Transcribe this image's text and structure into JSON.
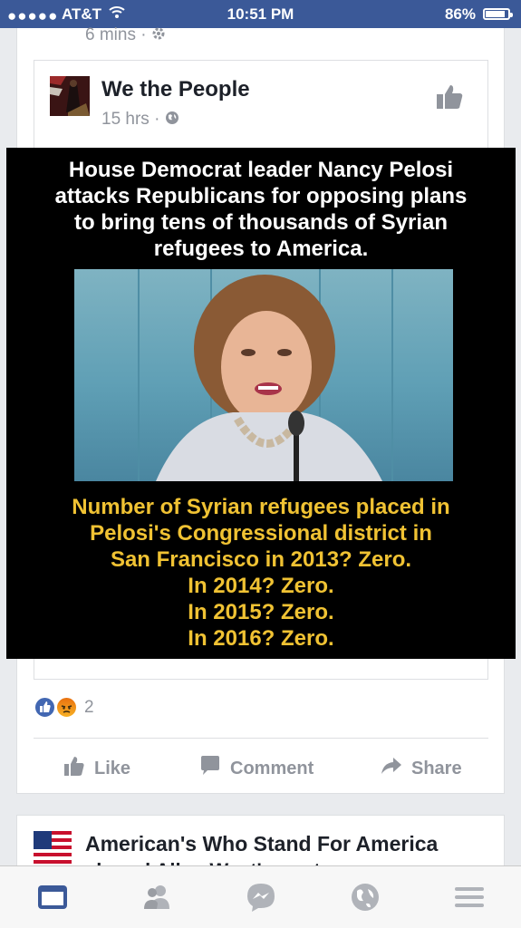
{
  "status_bar": {
    "signal_dots": "●●●●●",
    "carrier": "AT&T",
    "time": "10:51 PM",
    "battery_percent": "86%",
    "battery_level": 0.86
  },
  "previous_post": {
    "meta": "6 mins ·"
  },
  "post": {
    "page_name": "We the People",
    "meta": "15 hrs ·",
    "image": {
      "headline": [
        "House Democrat leader Nancy Pelosi",
        "attacks Republicans for opposing plans",
        "to bring tens of thousands of Syrian",
        "refugees to America."
      ],
      "caption": [
        "Number of Syrian refugees placed in",
        "Pelosi's Congressional district in",
        "San Francisco in 2013?  Zero.",
        "In 2014?  Zero.",
        "In 2015?  Zero.",
        "In 2016?  Zero."
      ]
    },
    "reaction_count": "2",
    "actions": {
      "like": "Like",
      "comment": "Comment",
      "share": "Share"
    }
  },
  "next_post": {
    "page_name": "American's Who Stand For America",
    "subtitle": "shared Allen West's post."
  },
  "tab_bar": {
    "tabs": [
      "news-feed",
      "friends",
      "messenger",
      "notifications",
      "menu"
    ],
    "active": "news-feed"
  },
  "colors": {
    "brand_blue": "#3b5998",
    "meme_caption": "#f0c233",
    "meta_gray": "#90949c"
  }
}
